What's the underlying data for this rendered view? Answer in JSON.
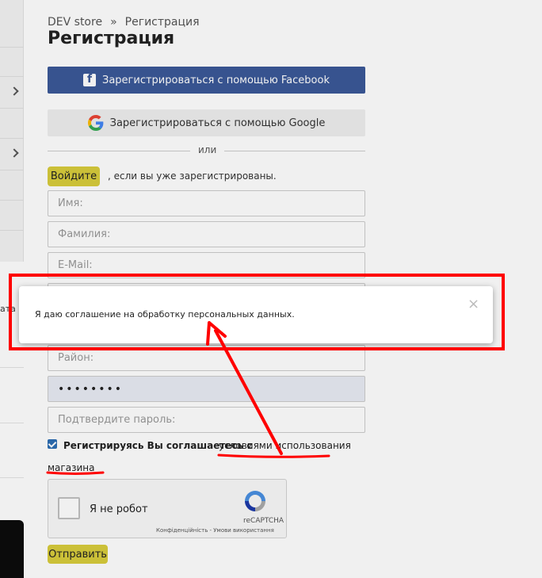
{
  "breadcrumb": {
    "home": "DEV store",
    "separator": "»",
    "current": "Регистрация"
  },
  "page": {
    "title": "Регистрация"
  },
  "social": {
    "facebook_label": "Зарегистрироваться с помощью Facebook",
    "google_label": "Зарегистрироваться с помощью Google"
  },
  "divider": {
    "text": "или"
  },
  "login": {
    "button_label": "Войдите",
    "hint": ", если вы уже зарегистрированы."
  },
  "form": {
    "name_placeholder": "Имя:",
    "surname_placeholder": "Фамилия:",
    "email_placeholder": "E-Mail:",
    "district_placeholder": "Район:",
    "password_value": "••••••••",
    "confirm_placeholder": "Подтвердите пароль:"
  },
  "agreement": {
    "bold_text": "Регистрируясь Вы соглашаетесь с",
    "link_text_1": "условиями использования",
    "link_text_2": "магазина",
    "checked": true
  },
  "recaptcha": {
    "label": "Я не робот",
    "brand": "reCAPTCHA",
    "terms": "Конфіденційність - Умови використання"
  },
  "submit": {
    "label": "Отправить"
  },
  "tooltip": {
    "message": "Я даю соглашение на обработку персональных данных.",
    "close": "×"
  },
  "sidebar": {
    "partial_text": "ата"
  },
  "colors": {
    "facebook": "#3b5998",
    "accent": "#d8cc3c",
    "annotation": "#ff0000"
  }
}
